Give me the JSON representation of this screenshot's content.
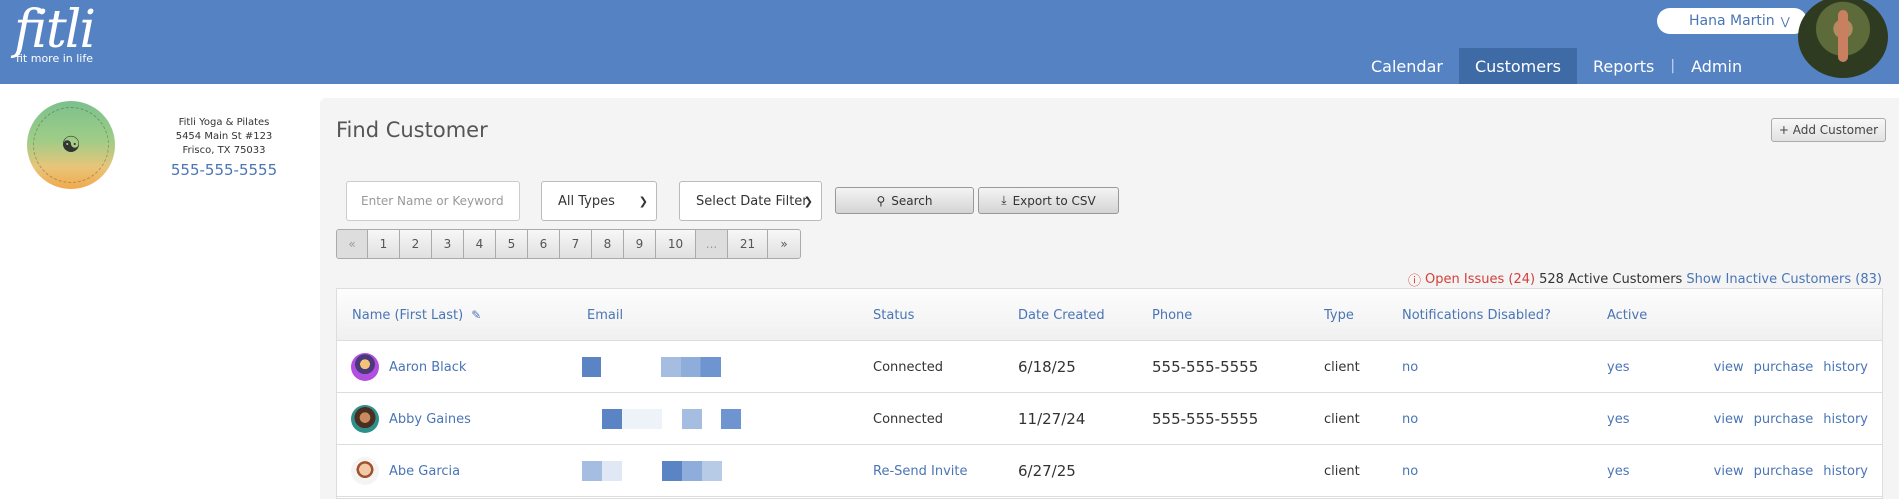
{
  "brand": {
    "logo_text": "fitli",
    "tagline": "fit more in life"
  },
  "user": {
    "name": "Hana Martin",
    "menu_icon": "chevron-double-down-icon"
  },
  "nav": {
    "items": [
      {
        "label": "Calendar",
        "active": false
      },
      {
        "label": "Customers",
        "active": true
      },
      {
        "label": "Reports",
        "active": false
      },
      {
        "label": "Admin",
        "active": false
      }
    ]
  },
  "studio": {
    "logo_text": "FITLI YOGA & PILATES",
    "name": "Fitli Yoga & Pilates",
    "address1": "5454 Main St #123",
    "address2": "Frisco, TX 75033",
    "phone": "555-555-5555"
  },
  "page": {
    "title": "Find Customer",
    "add_button": "+ Add Customer"
  },
  "filters": {
    "search_placeholder": "Enter Name or Keyword",
    "type_select": "All Types",
    "date_select": "Select Date Filter",
    "search_button": "Search",
    "export_button": "Export to CSV"
  },
  "pager": [
    "«",
    "1",
    "2",
    "3",
    "4",
    "5",
    "6",
    "7",
    "8",
    "9",
    "10",
    "...",
    "21",
    "»"
  ],
  "summary": {
    "issues": "Open Issues (24)",
    "active": "528 Active Customers",
    "inactive": "Show Inactive Customers (83)"
  },
  "table": {
    "headers": [
      "Name (First Last)",
      "Email",
      "Status",
      "Date Created",
      "Phone",
      "Type",
      "Notifications Disabled?",
      "Active"
    ],
    "rows": [
      {
        "name": "Aaron Black",
        "status": "Connected",
        "status_link": false,
        "date": "6/18/25",
        "phone": "555-555-5555",
        "type": "client",
        "notifications": "no",
        "active": "yes",
        "actions": [
          "view",
          "purchase",
          "history"
        ]
      },
      {
        "name": "Abby Gaines",
        "status": "Connected",
        "status_link": false,
        "date": "11/27/24",
        "phone": "555-555-5555",
        "type": "client",
        "notifications": "no",
        "active": "yes",
        "actions": [
          "view",
          "purchase",
          "history"
        ]
      },
      {
        "name": "Abe Garcia",
        "status": "Re-Send Invite",
        "status_link": true,
        "date": "6/27/25",
        "phone": "",
        "type": "client",
        "notifications": "no",
        "active": "yes",
        "actions": [
          "view",
          "purchase",
          "history"
        ]
      }
    ]
  },
  "colors": {
    "header": "#5582c2",
    "nav_active": "#3e6aa5",
    "link": "#4a75b5",
    "issues": "#d43f3a"
  }
}
